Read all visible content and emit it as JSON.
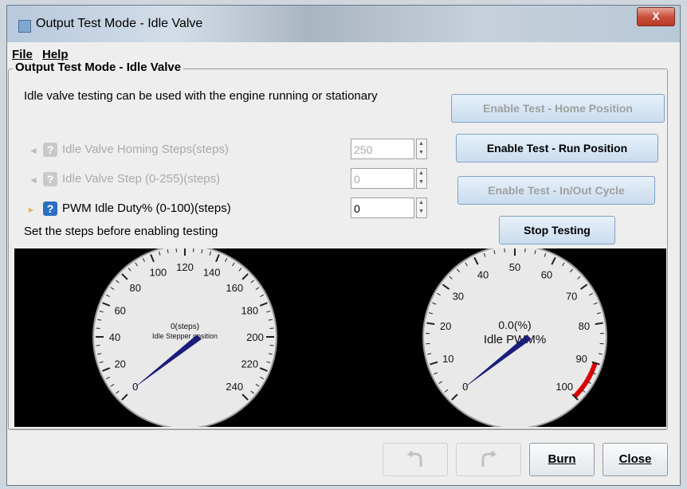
{
  "window": {
    "title": "Output Test Mode - Idle Valve",
    "close_label": "X"
  },
  "menu": {
    "file": "File",
    "help": "Help"
  },
  "panel": {
    "group_title": "Output Test Mode - Idle Valve",
    "description": "Idle valve testing can be used with the engine running or stationary",
    "hint": "Set the steps before enabling testing",
    "settings": [
      {
        "label": "Idle Valve Homing Steps(steps)",
        "value": "250",
        "enabled": false
      },
      {
        "label": "Idle Valve Step (0-255)(steps)",
        "value": "0",
        "enabled": false
      },
      {
        "label": "PWM Idle Duty% (0-100)(steps)",
        "value": "0",
        "enabled": true
      }
    ],
    "help_glyph": "?"
  },
  "buttons": {
    "home": "Enable Test - Home Position",
    "run": "Enable Test - Run Position",
    "inout": "Enable Test - In/Out Cycle",
    "stop": "Stop Testing",
    "burn": "Burn",
    "close": "Close",
    "undo_icon": "undo-icon",
    "redo_icon": "redo-icon"
  },
  "gauges": [
    {
      "value_text": "0(steps)",
      "title": "Idle Stepper position",
      "min": 0,
      "max": 255,
      "value": 0,
      "ticks": [
        "0",
        "20",
        "40",
        "60",
        "80",
        "100",
        "120",
        "140",
        "160",
        "180",
        "200",
        "220",
        "240"
      ]
    },
    {
      "value_text": "0.0(%)",
      "title": "Idle PWM%",
      "min": 0,
      "max": 100,
      "value": 0,
      "red_from": 90,
      "red_to": 100,
      "ticks": [
        "0",
        "10",
        "20",
        "30",
        "40",
        "50",
        "60",
        "70",
        "80",
        "90",
        "100"
      ]
    }
  ],
  "colors": {
    "needle": "#1c1c7a",
    "redline": "#dd0000",
    "gauge_face": "#e9e9e9"
  }
}
